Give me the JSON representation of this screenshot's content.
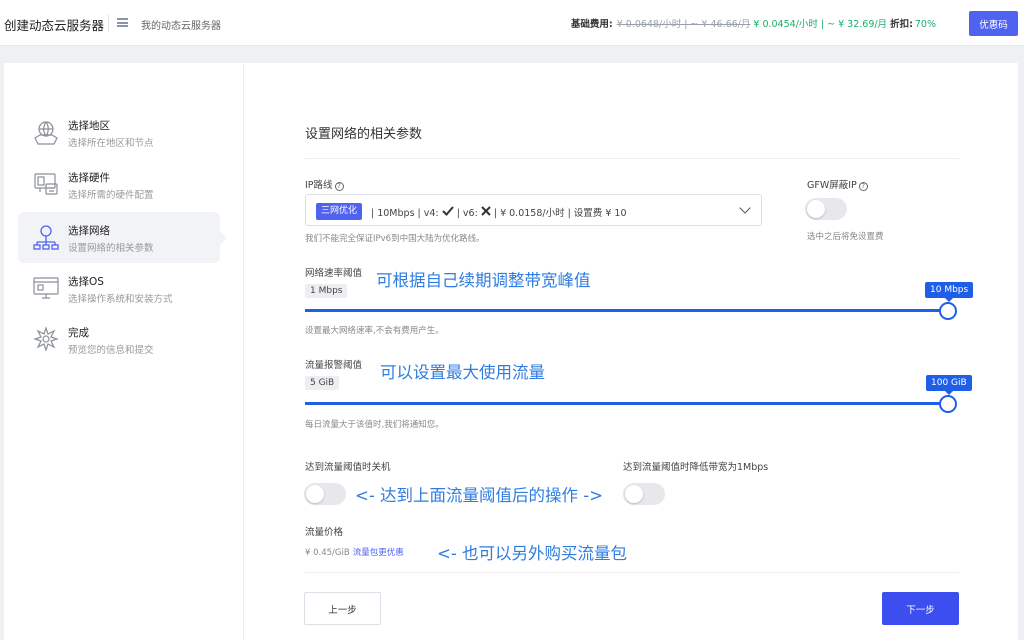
{
  "header": {
    "title": "创建动态云服务器",
    "breadcrumb": "我的动态云服务器",
    "base_label": "基础费用:",
    "old_price": "¥ 0.0648/小时 | ~ ¥ 46.66/月",
    "new_price": "¥ 0.0454/小时 | ~ ¥ 32.69/月",
    "discount_label": "折扣:",
    "discount_value": "70%",
    "coupon_label": "优惠码"
  },
  "sidebar": {
    "items": [
      {
        "title": "选择地区",
        "subtitle": "选择所在地区和节点",
        "icon": "region-icon",
        "active": false
      },
      {
        "title": "选择硬件",
        "subtitle": "选择所需的硬件配置",
        "icon": "hardware-icon",
        "active": false
      },
      {
        "title": "选择网络",
        "subtitle": "设置网络的相关参数",
        "icon": "network-icon",
        "active": true
      },
      {
        "title": "选择OS",
        "subtitle": "选择操作系统和安装方式",
        "icon": "os-icon",
        "active": false
      },
      {
        "title": "完成",
        "subtitle": "预览您的信息和提交",
        "icon": "finish-icon",
        "active": false
      }
    ]
  },
  "main": {
    "section_title": "设置网络的相关参数",
    "ip_route": {
      "label": "IP路线",
      "tag": "三网优化",
      "value_part1": "| 10Mbps | v4:",
      "value_part2": "| v6:",
      "value_part3": "| ¥ 0.0158/小时 | 设置费 ¥ 10",
      "hint": "我们不能完全保证IPv6到中国大陆为优化路线。"
    },
    "gfw": {
      "label": "GFW屏蔽IP",
      "hint": "选中之后将免设置费",
      "enabled": false
    },
    "bandwidth": {
      "label": "网络速率阈值",
      "min_label": "1 Mbps",
      "max_label": "10 Mbps",
      "value_fraction": 1.0,
      "hint": "设置最大网络速率,不会有费用产生。",
      "annotation": "可根据自己续期调整带宽峰值"
    },
    "traffic": {
      "label": "流量报警阈值",
      "min_label": "5 GiB",
      "max_label": "100 GiB",
      "value_fraction": 1.0,
      "hint": "每日流量大于该值时,我们将通知您。",
      "annotation": "可以设置最大使用流量"
    },
    "shutdown": {
      "label": "达到流量阈值时关机",
      "enabled": false
    },
    "throttle": {
      "label": "达到流量阈值时降低带宽为1Mbps",
      "enabled": false
    },
    "threshold_annotation": "<- 达到上面流量阈值后的操作 ->",
    "traffic_price": {
      "label": "流量价格",
      "price": "¥ 0.45/GiB",
      "link": "流量包更优惠",
      "annotation": "<- 也可以另外购买流量包"
    },
    "prev_label": "上一步",
    "next_label": "下一步"
  },
  "colors": {
    "accent": "#4f62f0",
    "slider": "#1f5fe8",
    "annotation": "#2f7de1",
    "green": "#19b06b"
  }
}
